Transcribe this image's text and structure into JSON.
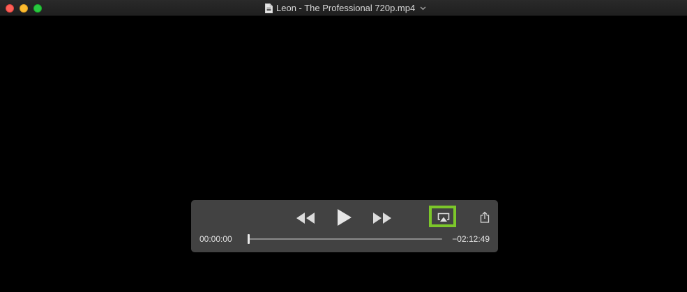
{
  "window": {
    "title": "Leon - The Professional 720p.mp4",
    "file_icon": "document-icon",
    "title_menu_icon": "chevron-down-icon"
  },
  "player": {
    "elapsed": "00:00:00",
    "remaining": "−02:12:49",
    "progress": 0,
    "icons": {
      "rewind": "rewind-icon",
      "play": "play-icon",
      "fast_forward": "fast-forward-icon",
      "airplay": "airplay-icon",
      "share": "share-icon"
    }
  },
  "colors": {
    "background": "#000000",
    "controls_bg": "#484848",
    "highlight": "#7cc72a",
    "close": "#fe5f57",
    "minimize": "#febc2e",
    "maximize": "#28c840"
  }
}
